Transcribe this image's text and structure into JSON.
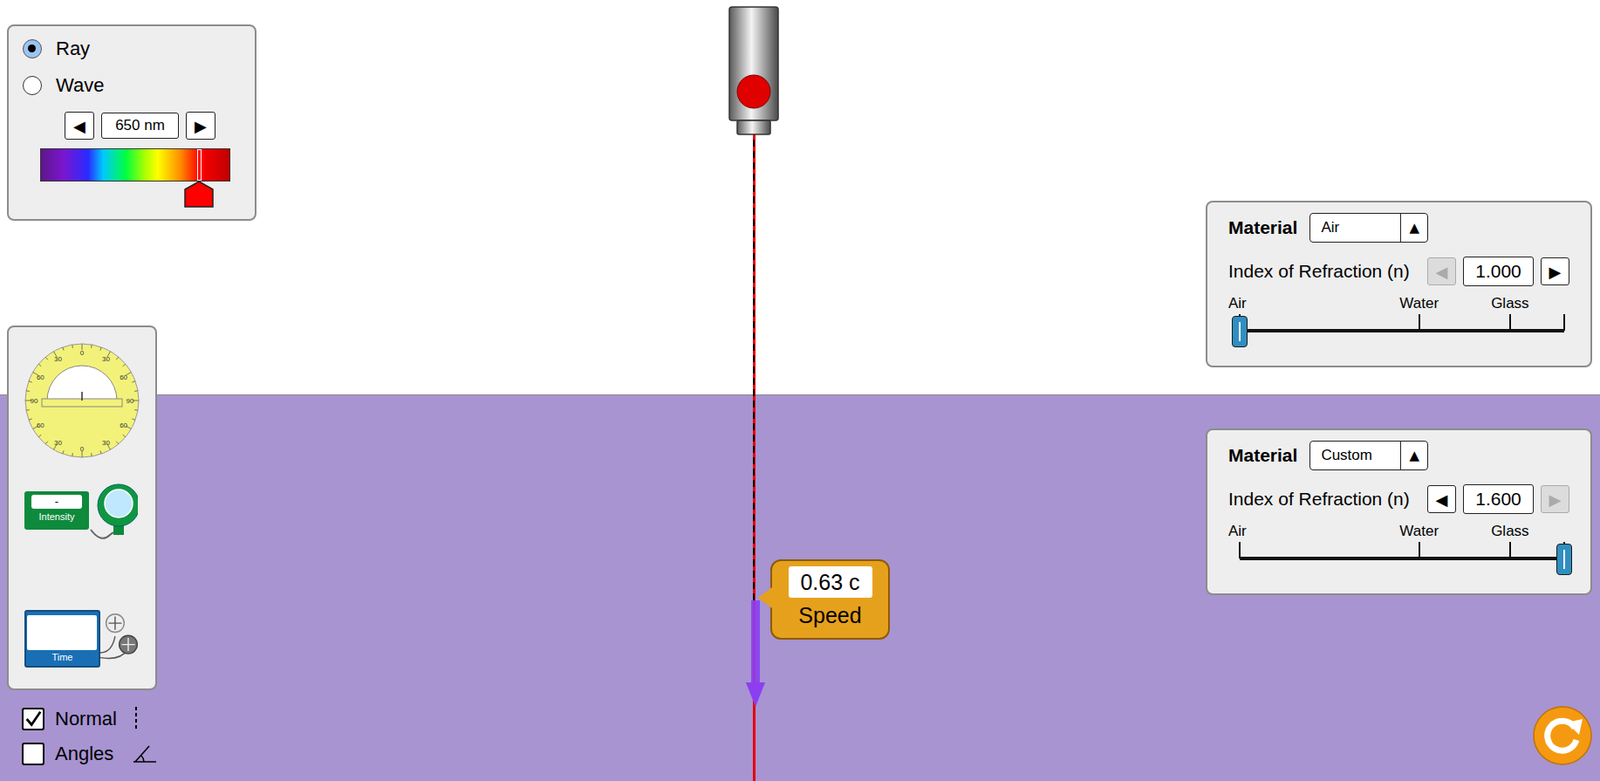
{
  "mode_options": [
    {
      "label": "Ray",
      "selected": true
    },
    {
      "label": "Wave",
      "selected": false
    }
  ],
  "wavelength": {
    "value": "650 nm",
    "decrease": "◀",
    "increase": "▶",
    "level": 0.84
  },
  "protractor": {
    "labels": [
      "0",
      "30",
      "60",
      "90",
      "60",
      "30",
      "0",
      "30",
      "60",
      "90",
      "60",
      "30"
    ]
  },
  "intensity_meter": {
    "reading": "-",
    "label": "Intensity"
  },
  "time_meter": {
    "label": "Time"
  },
  "checkboxes": [
    {
      "label": "Normal",
      "checked": true
    },
    {
      "label": "Angles",
      "checked": false
    }
  ],
  "materials": [
    {
      "heading": "Material",
      "value": "Air",
      "dropdown_arrow": "▲",
      "index_label": "Index of Refraction (n)",
      "index": "1.000",
      "decrease": "◀",
      "increase": "▶",
      "decrease_disabled": true,
      "increase_disabled": false,
      "ticks": [
        "Air",
        "Water",
        "Glass"
      ],
      "level": 0
    },
    {
      "heading": "Material",
      "value": "Custom",
      "dropdown_arrow": "▲",
      "index_label": "Index of Refraction (n)",
      "index": "1.600",
      "decrease": "◀",
      "increase": "▶",
      "decrease_disabled": false,
      "increase_disabled": true,
      "ticks": [
        "Air",
        "Water",
        "Glass"
      ],
      "level": 1
    }
  ],
  "speed_tool": {
    "reading": "0.63 c",
    "label": "Speed"
  }
}
